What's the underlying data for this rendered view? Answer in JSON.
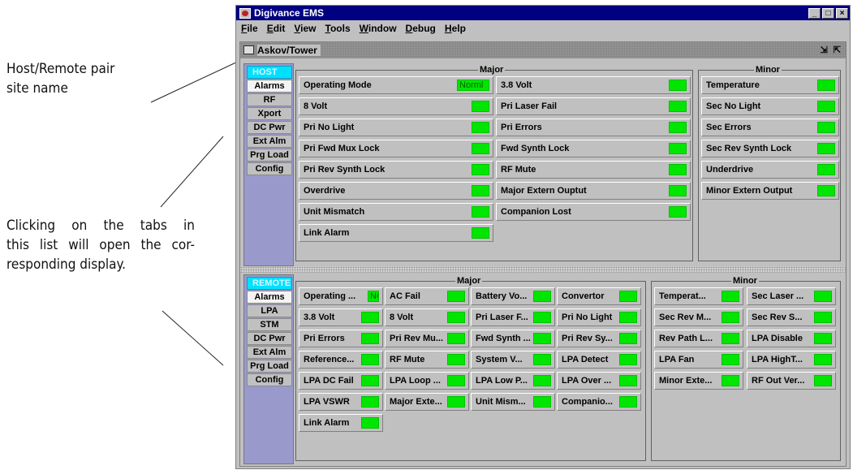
{
  "annotations": {
    "site_name": [
      "Host/Remote pair",
      "site name"
    ],
    "tabs_note": [
      "Clicking on the tabs in",
      "this list will open the cor-",
      "responding display."
    ]
  },
  "window": {
    "title": "Digivance EMS",
    "controls": [
      "_",
      "□",
      "×"
    ],
    "menu": [
      "File",
      "Edit",
      "View",
      "Tools",
      "Window",
      "Debug",
      "Help"
    ]
  },
  "site": {
    "title": "Askov/Tower",
    "window_controls": "⇲ ⇱"
  },
  "host": {
    "tabs": [
      "HOST",
      "Alarms",
      "RF",
      "Xport",
      "DC Pwr",
      "Ext Alm",
      "Prg Load",
      "Config"
    ],
    "major_label": "Major",
    "minor_label": "Minor",
    "major_col1": [
      {
        "label": "Operating Mode",
        "value": "Norml"
      },
      {
        "label": "8 Volt"
      },
      {
        "label": "Pri No Light"
      },
      {
        "label": "Pri Fwd Mux Lock"
      },
      {
        "label": "Pri Rev Synth Lock"
      },
      {
        "label": "Overdrive"
      },
      {
        "label": "Unit Mismatch"
      },
      {
        "label": "Link Alarm"
      }
    ],
    "major_col2": [
      {
        "label": "3.8 Volt"
      },
      {
        "label": "Pri Laser Fail"
      },
      {
        "label": "Pri Errors"
      },
      {
        "label": "Fwd Synth Lock"
      },
      {
        "label": "RF Mute"
      },
      {
        "label": "Major Extern Ouptut"
      },
      {
        "label": "Companion Lost"
      }
    ],
    "minor": [
      {
        "label": "Temperature"
      },
      {
        "label": "Sec No Light"
      },
      {
        "label": "Sec Errors"
      },
      {
        "label": "Sec Rev Synth Lock"
      },
      {
        "label": "Underdrive"
      },
      {
        "label": "Minor Extern Output"
      }
    ]
  },
  "remote": {
    "tabs": [
      "REMOTE",
      "Alarms",
      "LPA",
      "STM",
      "DC Pwr",
      "Ext Alm",
      "Prg Load",
      "Config"
    ],
    "major_label": "Major",
    "minor_label": "Minor",
    "major_grid": [
      [
        {
          "label": "Operating ...",
          "value": "NC"
        },
        {
          "label": "AC Fail"
        },
        {
          "label": "Battery Vo..."
        },
        {
          "label": "Convertor"
        }
      ],
      [
        {
          "label": "3.8 Volt"
        },
        {
          "label": "8 Volt"
        },
        {
          "label": "Pri Laser F..."
        },
        {
          "label": "Pri No Light"
        }
      ],
      [
        {
          "label": "Pri Errors"
        },
        {
          "label": "Pri Rev Mu..."
        },
        {
          "label": "Fwd Synth ..."
        },
        {
          "label": "Pri Rev Sy..."
        }
      ],
      [
        {
          "label": "Reference..."
        },
        {
          "label": "RF Mute"
        },
        {
          "label": "System V..."
        },
        {
          "label": "LPA Detect"
        }
      ],
      [
        {
          "label": "LPA DC Fail"
        },
        {
          "label": "LPA Loop ..."
        },
        {
          "label": "LPA Low P..."
        },
        {
          "label": "LPA Over ..."
        }
      ],
      [
        {
          "label": "LPA VSWR"
        },
        {
          "label": "Major Exte..."
        },
        {
          "label": "Unit Mism..."
        },
        {
          "label": "Companio..."
        }
      ],
      [
        {
          "label": "Link Alarm"
        }
      ]
    ],
    "minor_grid": [
      [
        {
          "label": "Temperat..."
        },
        {
          "label": "Sec Laser ..."
        }
      ],
      [
        {
          "label": "Sec Rev M..."
        },
        {
          "label": "Sec Rev S..."
        }
      ],
      [
        {
          "label": "Rev Path L..."
        },
        {
          "label": "LPA Disable"
        }
      ],
      [
        {
          "label": "LPA Fan"
        },
        {
          "label": "LPA HighT..."
        }
      ],
      [
        {
          "label": "Minor Exte..."
        },
        {
          "label": "RF Out Ver..."
        }
      ]
    ]
  },
  "colors": {
    "ok": "#00e600",
    "tab_head": "#00e0ff",
    "tab_bar": "#9999cc",
    "titlebar": "#000080"
  }
}
